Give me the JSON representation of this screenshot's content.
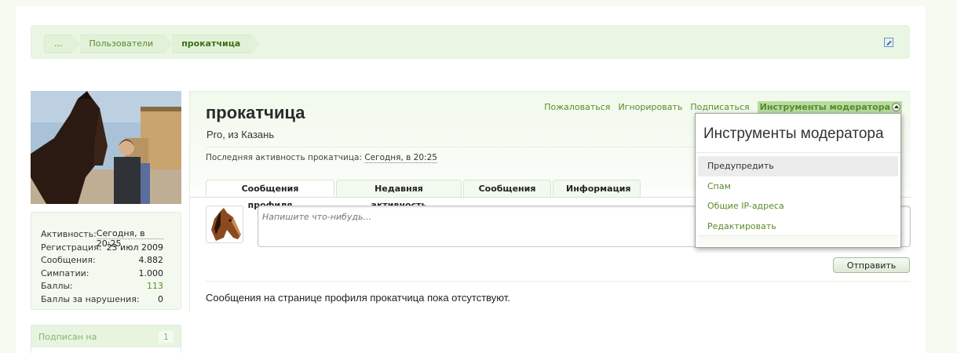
{
  "breadcrumb": {
    "items": [
      "...",
      "Пользователи",
      "прокатчица"
    ]
  },
  "profile": {
    "username": "прокатчица",
    "title": "Pro, из Казань",
    "last_activity_label": "Последняя активность прокатчица:",
    "last_activity_time": "Сегодня, в 20:25"
  },
  "actions": {
    "report": "Пожаловаться",
    "ignore": "Игнорировать",
    "follow": "Подписаться",
    "mod_tools": "Инструменты модератора"
  },
  "stats": [
    {
      "label": "Активность:",
      "value": "Сегодня, в 20:25"
    },
    {
      "label": "Регистрация:",
      "value": "23 июл 2009"
    },
    {
      "label": "Сообщения:",
      "value": "4.882"
    },
    {
      "label": "Симпатии:",
      "value": "1.000"
    },
    {
      "label": "Баллы:",
      "value": "113"
    },
    {
      "label": "Баллы за нарушения:",
      "value": "0"
    }
  ],
  "following": {
    "label": "Подписан на",
    "count": "1"
  },
  "tabs": [
    {
      "label": "Сообщения профиля"
    },
    {
      "label": "Недавняя активность"
    },
    {
      "label": "Сообщения"
    },
    {
      "label": "Информация"
    }
  ],
  "post": {
    "placeholder": "Напишите что-нибудь...",
    "submit": "Отправить",
    "empty_text": "Сообщения на странице профиля прокатчица пока отсутствуют."
  },
  "mod_menu": {
    "title": "Инструменты модератора",
    "items": [
      {
        "label": "Предупредить"
      },
      {
        "label": "Спам"
      },
      {
        "label": "Общие IP-адреса"
      },
      {
        "label": "Редактировать"
      }
    ]
  },
  "colors": {
    "accent": "#5a8a2a",
    "header_bg": "#eaf6e4",
    "mod_tools_bg": "#b7dba0"
  }
}
